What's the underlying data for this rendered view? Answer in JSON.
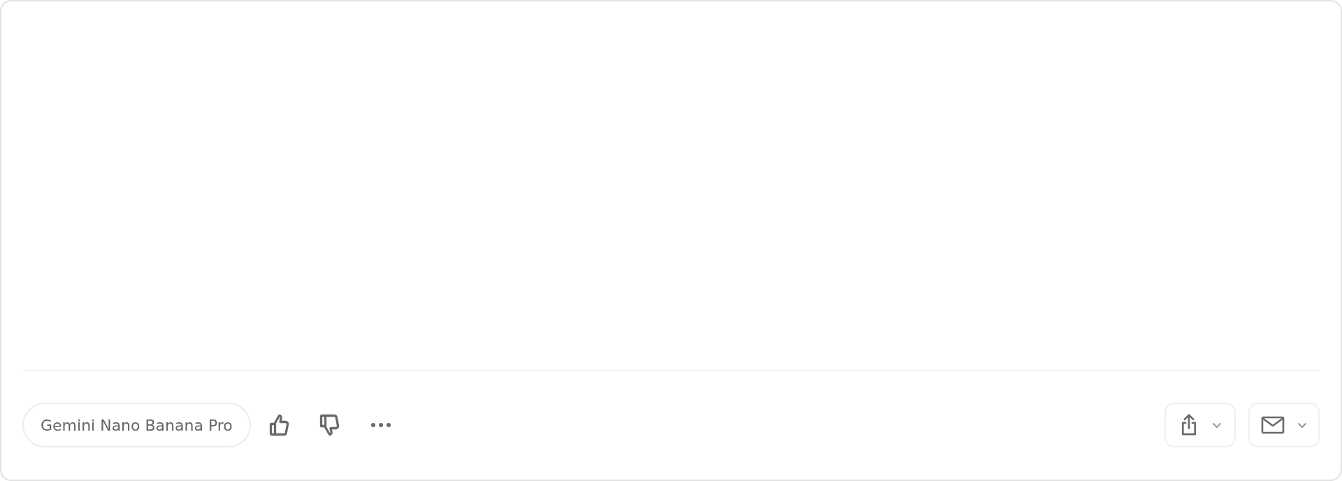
{
  "footer": {
    "model_label": "Gemini Nano Banana Pro"
  }
}
